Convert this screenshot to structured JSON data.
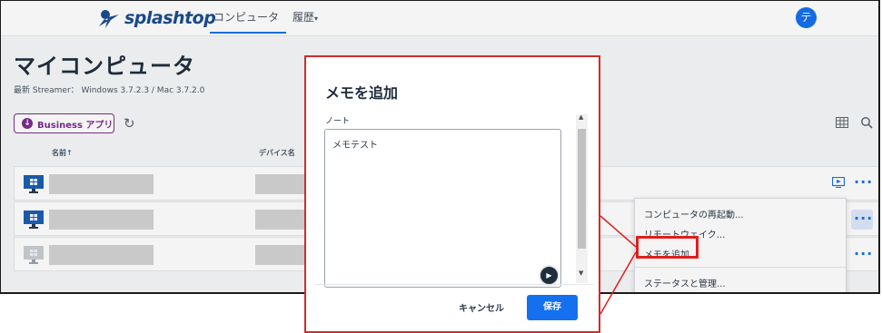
{
  "app": {
    "brand": "splashtop",
    "nav": {
      "computers": "コンピュータ",
      "history": "履歴"
    },
    "avatar_initial": "テ"
  },
  "page": {
    "title": "マイコンピュータ",
    "streamer_info": "最新 Streamer： Windows 3.7.2.3 / Mac 3.7.2.0",
    "business_app_button": "Business アプリ"
  },
  "table": {
    "columns": {
      "name": "名前",
      "device": "デバイス名"
    }
  },
  "context_menu": {
    "items": [
      "コンピュータの再起動...",
      "リモートウェイク...",
      "メモを追加...",
      "ステータスと管理..."
    ]
  },
  "modal": {
    "title": "メモを追加",
    "note_label": "ノート",
    "note_value": "メモテスト",
    "cancel_label": "キャンセル",
    "save_label": "保存"
  },
  "colors": {
    "accent": "#1570ef",
    "highlight": "#e01e1e",
    "business": "#7b2d8e"
  }
}
